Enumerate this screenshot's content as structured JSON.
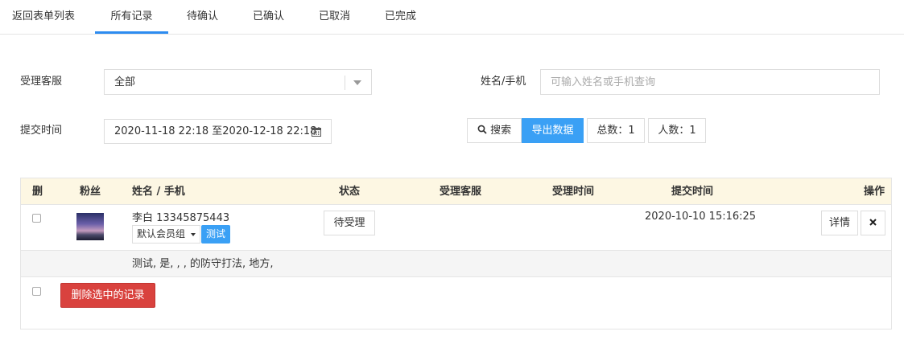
{
  "tabs": [
    "返回表单列表",
    "所有记录",
    "待确认",
    "已确认",
    "已取消",
    "已完成"
  ],
  "filters": {
    "agent_label": "受理客服",
    "agent_value": "全部",
    "name_label": "姓名/手机",
    "name_placeholder": "可输入姓名或手机查询",
    "time_label": "提交时间",
    "time_range": "2020-11-18 22:18 至2020-12-18 22:18"
  },
  "actions": {
    "search": "搜索",
    "export": "导出数据",
    "total": "总数：1",
    "people": "人数：1"
  },
  "table": {
    "headers": [
      "删",
      "粉丝",
      "姓名 / 手机",
      "状态",
      "受理客服",
      "受理时间",
      "提交时间",
      "操作"
    ],
    "row": {
      "name_phone": "李白 13345875443",
      "group": "默认会员组",
      "tag": "测试",
      "status": "待受理",
      "submit_time": "2020-10-10 15:16:25",
      "detail": "详情",
      "note": "测试, 是, , , 的防守打法, 地方,"
    },
    "delete_selected": "删除选中的记录"
  },
  "colors": {
    "accent": "#3aa0f5",
    "danger": "#d9423e",
    "header_bg": "#fdf7e3"
  }
}
